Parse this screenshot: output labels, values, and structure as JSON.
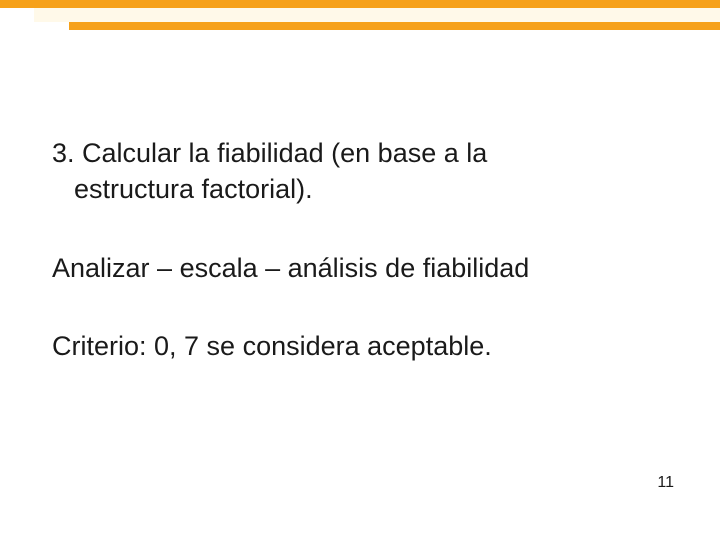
{
  "body": {
    "p1_line1": "3. Calcular la fiabilidad (en base a la",
    "p1_line2": "estructura factorial).",
    "p2": "Analizar – escala – análisis de fiabilidad",
    "p3": "Criterio: 0, 7 se considera aceptable."
  },
  "page_number": "11"
}
